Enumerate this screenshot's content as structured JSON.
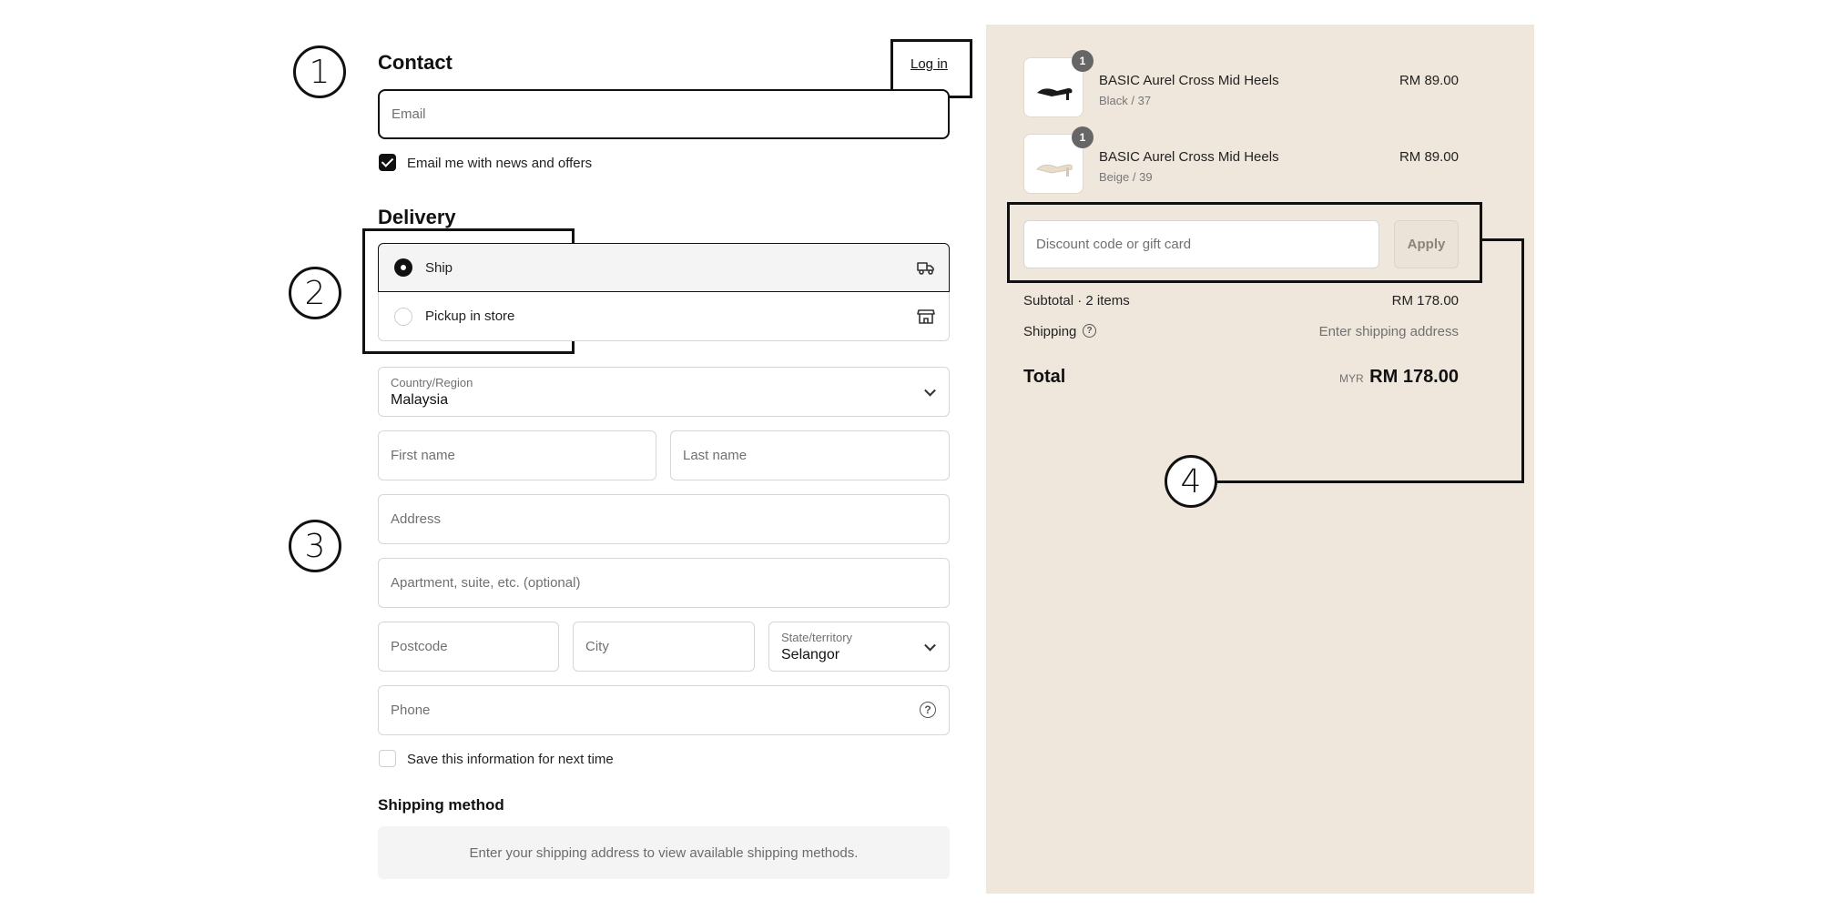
{
  "annotations": [
    "1",
    "2",
    "3",
    "4"
  ],
  "contact": {
    "heading": "Contact",
    "login_link": "Log in",
    "email_placeholder": "Email",
    "news_checkbox_label": "Email me with news and offers",
    "news_checked": true
  },
  "delivery": {
    "heading": "Delivery",
    "options": [
      {
        "label": "Ship",
        "selected": true,
        "icon": "truck-icon"
      },
      {
        "label": "Pickup in store",
        "selected": false,
        "icon": "store-icon"
      }
    ],
    "country_label": "Country/Region",
    "country_value": "Malaysia",
    "first_name_placeholder": "First name",
    "last_name_placeholder": "Last name",
    "address_placeholder": "Address",
    "apartment_placeholder": "Apartment, suite, etc. (optional)",
    "postcode_placeholder": "Postcode",
    "city_placeholder": "City",
    "state_label": "State/territory",
    "state_value": "Selangor",
    "phone_placeholder": "Phone",
    "save_info_label": "Save this information for next time",
    "save_info_checked": false
  },
  "shipping_method": {
    "heading": "Shipping method",
    "notice": "Enter your shipping address to view available shipping methods."
  },
  "summary": {
    "items": [
      {
        "qty": "1",
        "name": "BASIC Aurel Cross Mid Heels",
        "variant": "Black / 37",
        "price": "RM 89.00",
        "image_color": "#1a1a1a"
      },
      {
        "qty": "1",
        "name": "BASIC Aurel Cross Mid Heels",
        "variant": "Beige / 39",
        "price": "RM 89.00",
        "image_color": "#e8dccb"
      }
    ],
    "discount_placeholder": "Discount code or gift card",
    "apply_label": "Apply",
    "subtotal_label": "Subtotal · 2 items",
    "subtotal_value": "RM 178.00",
    "shipping_label": "Shipping",
    "shipping_value": "Enter shipping address",
    "total_label": "Total",
    "currency": "MYR",
    "total_value": "RM 178.00"
  },
  "colors": {
    "summary_bg": "#f0e7dc",
    "accent": "#111111"
  }
}
